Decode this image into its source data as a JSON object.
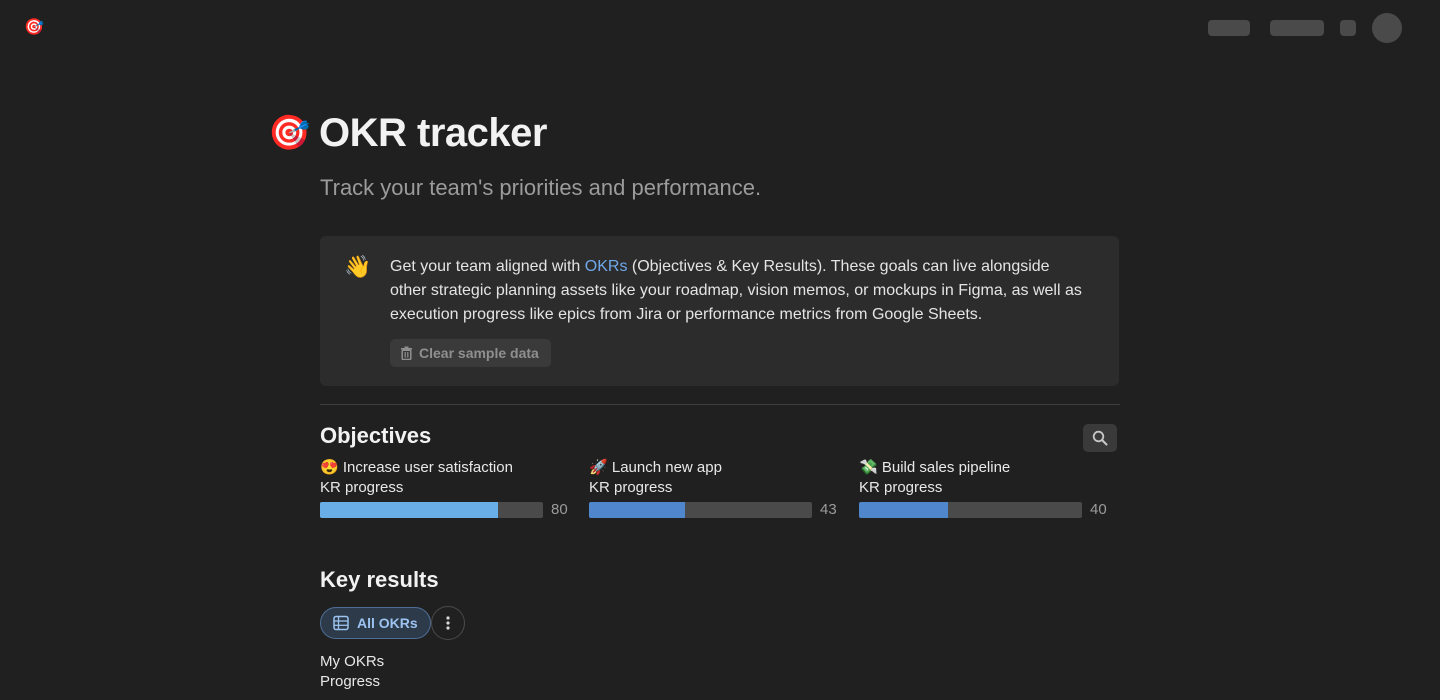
{
  "topbar": {
    "app_icon": "🎯"
  },
  "page": {
    "icon": "🎯",
    "title": "OKR tracker",
    "subtitle": "Track your team's priorities and performance."
  },
  "callout": {
    "icon": "👋",
    "text_before": "Get your team aligned with ",
    "link": "OKRs",
    "text_after": " (Objectives & Key Results). These goals can live alongside other strategic planning assets like your roadmap, vision memos, or mockups in Figma, as well as execution progress like epics from Jira or performance metrics from Google Sheets.",
    "clear_button": "Clear sample data"
  },
  "objectives": {
    "heading": "Objectives",
    "items": [
      {
        "emoji": "😍",
        "title": "Increase user satisfaction",
        "kr_label": "KR progress",
        "progress": 80,
        "color": "#6aaee8"
      },
      {
        "emoji": "🚀",
        "title": "Launch new app",
        "kr_label": "KR progress",
        "progress": 43,
        "color": "#4f86cc"
      },
      {
        "emoji": "💸",
        "title": "Build sales pipeline",
        "kr_label": "KR progress",
        "progress": 40,
        "color": "#4f86cc"
      }
    ]
  },
  "key_results": {
    "heading": "Key results",
    "view_tab": "All OKRs",
    "filter_label": "My OKRs",
    "progress_label": "Progress"
  }
}
